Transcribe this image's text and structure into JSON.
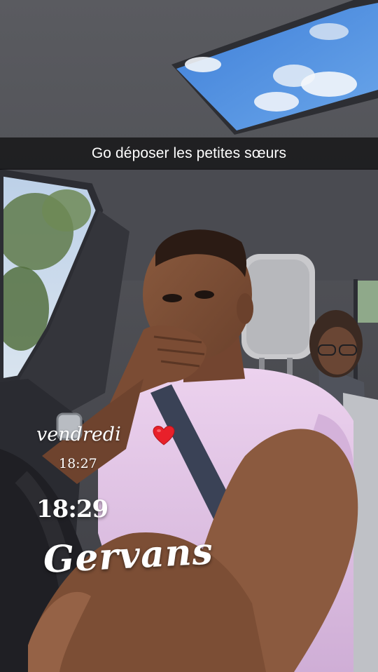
{
  "caption": {
    "text": "Go déposer les petites sœurs"
  },
  "stickers": {
    "day": "vendredi",
    "heart_icon": "red-heart-icon",
    "time_small": "18:27",
    "time_big": "18:29",
    "name": "Gervans"
  },
  "colors": {
    "caption_bar": "#000000",
    "text": "#ffffff",
    "heart": "#e8202a",
    "shirt": "#e6c6e8",
    "sky": "#4f8fe0"
  }
}
